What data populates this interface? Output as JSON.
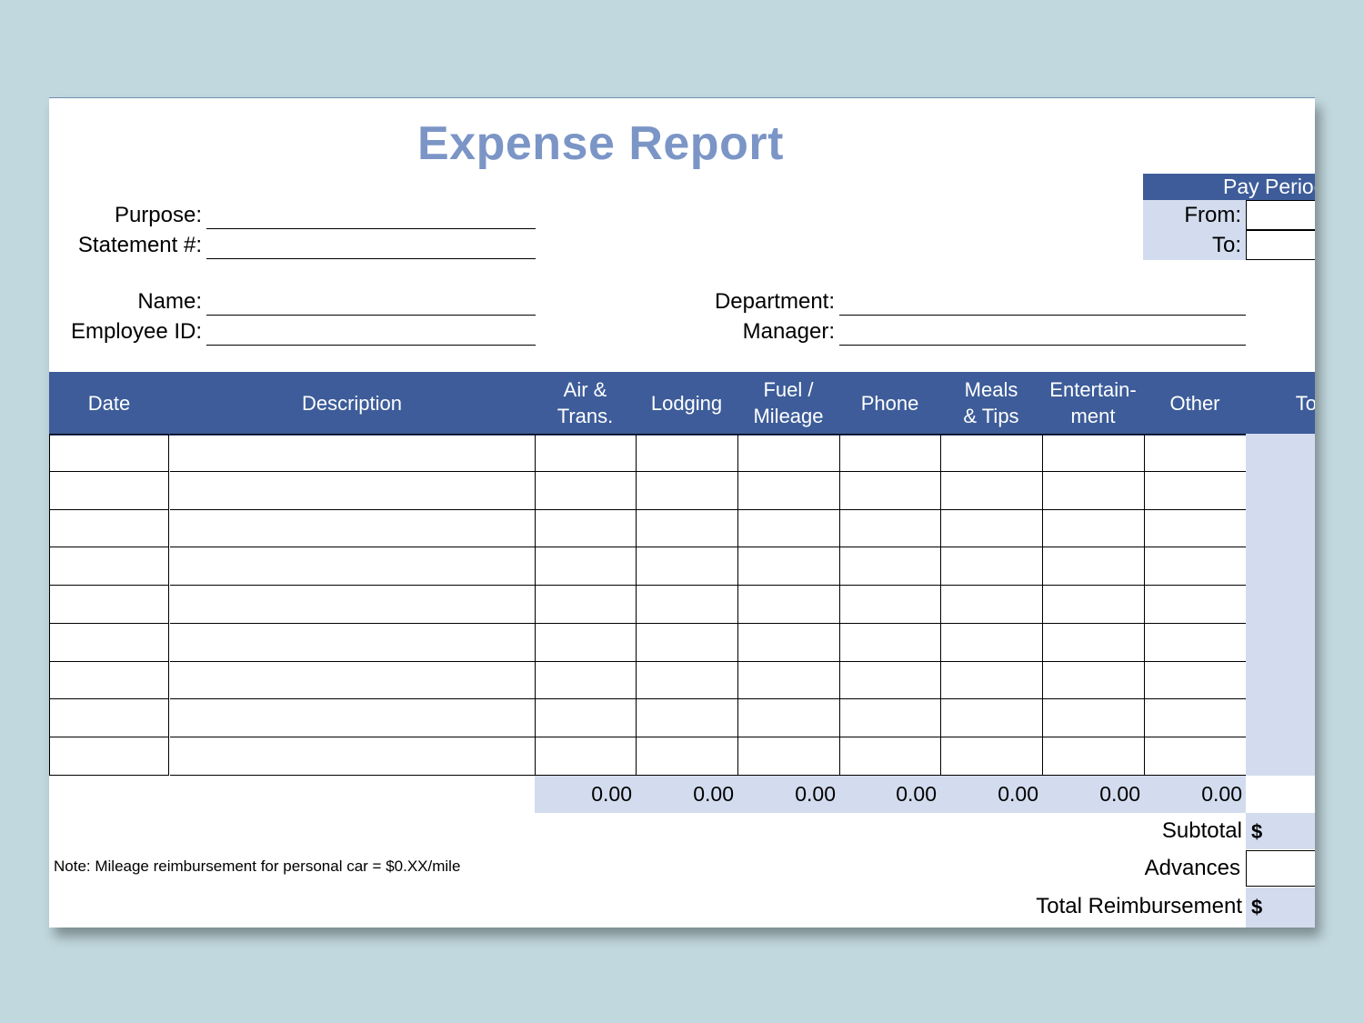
{
  "title": "Expense Report",
  "fields": {
    "purpose_label": "Purpose:",
    "statement_label": "Statement #:",
    "name_label": "Name:",
    "employee_id_label": "Employee ID:",
    "department_label": "Department:",
    "manager_label": "Manager:"
  },
  "pay_period": {
    "heading": "Pay Period",
    "from_label": "From:",
    "to_label": "To:"
  },
  "table": {
    "columns": [
      "Date",
      "Description",
      "Air &\nTrans.",
      "Lodging",
      "Fuel /\nMileage",
      "Phone",
      "Meals\n& Tips",
      "Entertain-\nment",
      "Other",
      "Total"
    ],
    "row_count": 9,
    "column_totals": [
      "0.00",
      "0.00",
      "0.00",
      "0.00",
      "0.00",
      "0.00",
      "0.00"
    ]
  },
  "summary": {
    "subtotal_label": "Subtotal",
    "subtotal_currency": "$",
    "advances_label": "Advances",
    "total_label": "Total Reimbursement",
    "total_currency": "$"
  },
  "note": "Note: Mileage reimbursement for personal car = $0.XX/mile",
  "colors": {
    "background": "#c1d8de",
    "header_blue": "#3d5c99",
    "title_blue": "#7b95c6",
    "light_fill": "#d3dcee"
  }
}
